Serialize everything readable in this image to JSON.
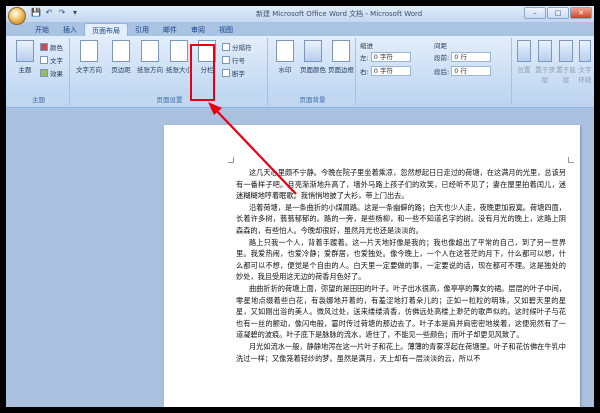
{
  "window": {
    "title": "新建 Microsoft Office Word 文档 - Microsoft Word",
    "buttons": {
      "minimize": "–",
      "maximize": "□",
      "close": "✕"
    }
  },
  "quick_access": [
    "💾",
    "↶",
    "↷",
    "▾"
  ],
  "tabs": [
    "开始",
    "插入",
    "页面布局",
    "引用",
    "邮件",
    "审阅",
    "视图"
  ],
  "active_tab": "页面布局",
  "ribbon": {
    "theme_group": {
      "label": "主题",
      "main": "主题",
      "colors": "颜色",
      "fonts": "文字",
      "effects": "效果"
    },
    "page_setup": {
      "label": "页面设置",
      "text_direction": "文字方向",
      "margins": "页边距",
      "orientation": "纸张方向",
      "size": "纸张大小",
      "columns": "分栏",
      "breaks": "分隔符",
      "line_numbers": "行号",
      "hyphenation": "断字"
    },
    "background": {
      "label": "页面背景",
      "watermark": "水印",
      "page_color": "页面颜色",
      "page_borders": "页面边框"
    },
    "paragraph": {
      "indent_label": "缩进",
      "spacing_label": "间距",
      "left": "左:",
      "right": "右:",
      "before": "段前:",
      "after": "段后:",
      "left_value": "0 字符",
      "right_value": "0 字符",
      "before_value": "0 行",
      "after_value": "0 行"
    },
    "arrange": {
      "position": "位置",
      "front": "置于顶层",
      "back": "置于底层",
      "wrap": "文字环绕"
    }
  },
  "document": {
    "paragraphs": [
      "这几天心里颇不宁静。今晚在院子里坐着乘凉，忽然想起日日走过的荷塘，在这满月的光里，总该另有一番样子吧。月亮渐渐地升高了，墙外马路上孩子们的欢笑，已经听不见了；妻在屋里拍着闰儿，迷迷糊糊地哼着眠歌。我悄悄地披了大衫，带上门出去。",
      "沿着荷塘，是一条曲折的小煤屑路。这是一条幽僻的路；白天也少人走，夜晚更加寂寞。荷塘四面，长着许多树，蓊蓊郁郁的。路的一旁，是些杨柳，和一些不知道名字的树。没有月光的晚上，这路上阴森森的，有些怕人。今晚却很好，虽然月光也还是淡淡的。",
      "路上只我一个人，背着手踱着。这一片天地好像是我的；我也像超出了平常的自己，到了另一世界里。我爱热闹，也爱冷静；爱群居，也爱独处。像今晚上，一个人在这苍茫的月下，什么都可以想，什么都可以不想，便觉是个自由的人。白天里一定要做的事，一定要说的话，现在都可不理。这是独处的妙处，我且受用这无边的荷香月色好了。",
      "曲曲折折的荷塘上面，弥望的是田田的叶子。叶子出水很高，像亭亭的舞女的裙。层层的叶子中间，零星地点缀着些白花，有袅娜地开着的，有羞涩地打着朵儿的；正如一粒粒的明珠，又如碧天里的星星，又如刚出浴的美人。微风过处，送来缕缕清香，仿佛远处高楼上渺茫的歌声似的。这时候叶子与花也有一丝的颤动，像闪电般，霎时传过荷塘的那边去了。叶子本是肩并肩密密地挨着，这便宛然有了一道凝碧的波痕。叶子底下是脉脉的流水，遮住了，不能见一些颜色；而叶子却更见风致了。",
      "月光如流水一般，静静地泻在这一片叶子和花上。薄薄的青雾浮起在荷塘里。叶子和花仿佛在牛乳中洗过一样；又像笼着轻纱的梦。虽然是满月，天上却有一层淡淡的云，所以不"
    ]
  },
  "annotation": {
    "highlight_color": "#e60012"
  }
}
